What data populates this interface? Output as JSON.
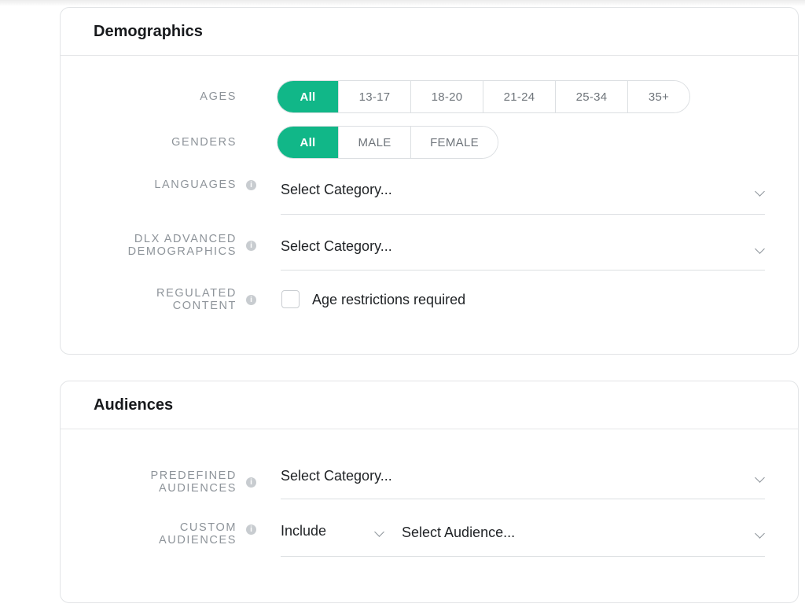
{
  "demographics": {
    "title": "Demographics",
    "ages": {
      "label": "AGES",
      "options": [
        "All",
        "13-17",
        "18-20",
        "21-24",
        "25-34",
        "35+"
      ]
    },
    "genders": {
      "label": "GENDERS",
      "options": [
        "All",
        "MALE",
        "FEMALE"
      ]
    },
    "languages": {
      "label": "LANGUAGES",
      "placeholder": "Select Category..."
    },
    "dlx": {
      "label_line1": "DLX ADVANCED",
      "label_line2": "DEMOGRAPHICS",
      "placeholder": "Select Category..."
    },
    "regulated": {
      "label_line1": "REGULATED",
      "label_line2": "CONTENT",
      "checkbox_label": "Age restrictions required"
    }
  },
  "audiences": {
    "title": "Audiences",
    "predefined": {
      "label_line1": "PREDEFINED",
      "label_line2": "AUDIENCES",
      "placeholder": "Select Category..."
    },
    "custom": {
      "label_line1": "CUSTOM",
      "label_line2": "AUDIENCES",
      "mode": "Include",
      "placeholder": "Select Audience..."
    }
  },
  "colors": {
    "accent": "#11b788",
    "label": "#8e949a",
    "border": "#dcdfe2"
  },
  "icons": {
    "info": "info-icon",
    "dropdown": "chevron-down-icon"
  }
}
